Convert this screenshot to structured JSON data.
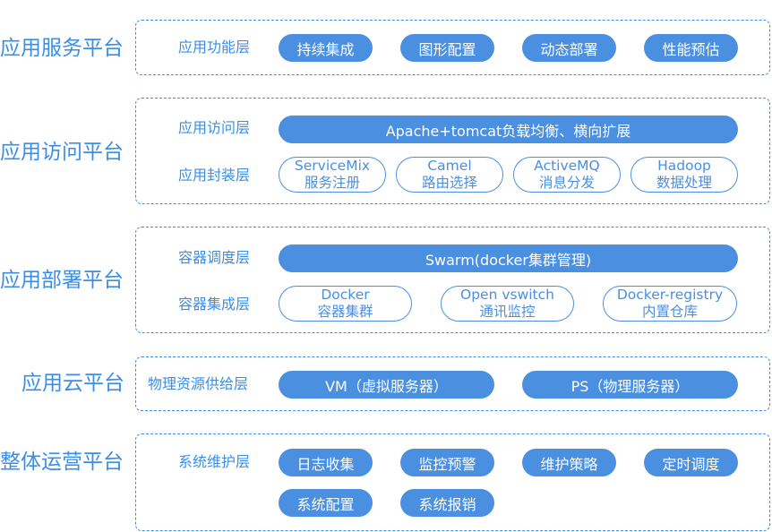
{
  "colors": {
    "accent": "#3a8ee6",
    "pill_fill": "#4a8fe0",
    "pill_text": "#ffffff"
  },
  "platforms": [
    {
      "label": "应用服务平台",
      "layers": [
        {
          "label": "应用功能层",
          "items": [
            "持续集成",
            "图形配置",
            "动态部署",
            "性能预估"
          ]
        }
      ]
    },
    {
      "label": "应用访问平台",
      "layers": [
        {
          "label": "应用访问层",
          "items": [
            "Apache+tomcat负载均衡、横向扩展"
          ]
        },
        {
          "label": "应用封装层",
          "items": [
            {
              "top": "ServiceMix",
              "bottom": "服务注册"
            },
            {
              "top": "Camel",
              "bottom": "路由选择"
            },
            {
              "top": "ActiveMQ",
              "bottom": "消息分发"
            },
            {
              "top": "Hadoop",
              "bottom": "数据处理"
            }
          ]
        }
      ]
    },
    {
      "label": "应用部署平台",
      "layers": [
        {
          "label": "容器调度层",
          "items": [
            "Swarm(docker集群管理)"
          ]
        },
        {
          "label": "容器集成层",
          "items": [
            {
              "top": "Docker",
              "bottom": "容器集群"
            },
            {
              "top": "Open vswitch",
              "bottom": "通讯监控"
            },
            {
              "top": "Docker-registry",
              "bottom": "内置仓库"
            }
          ]
        }
      ]
    },
    {
      "label": "应用云平台",
      "layers": [
        {
          "label": "物理资源供给层",
          "items": [
            "VM（虚拟服务器）",
            "PS（物理服务器）"
          ]
        }
      ]
    },
    {
      "label": "整体运营平台",
      "layers": [
        {
          "label": "系统维护层",
          "items": [
            "日志收集",
            "监控预警",
            "维护策略",
            "定时调度",
            "系统配置",
            "系统报销"
          ]
        }
      ]
    }
  ]
}
